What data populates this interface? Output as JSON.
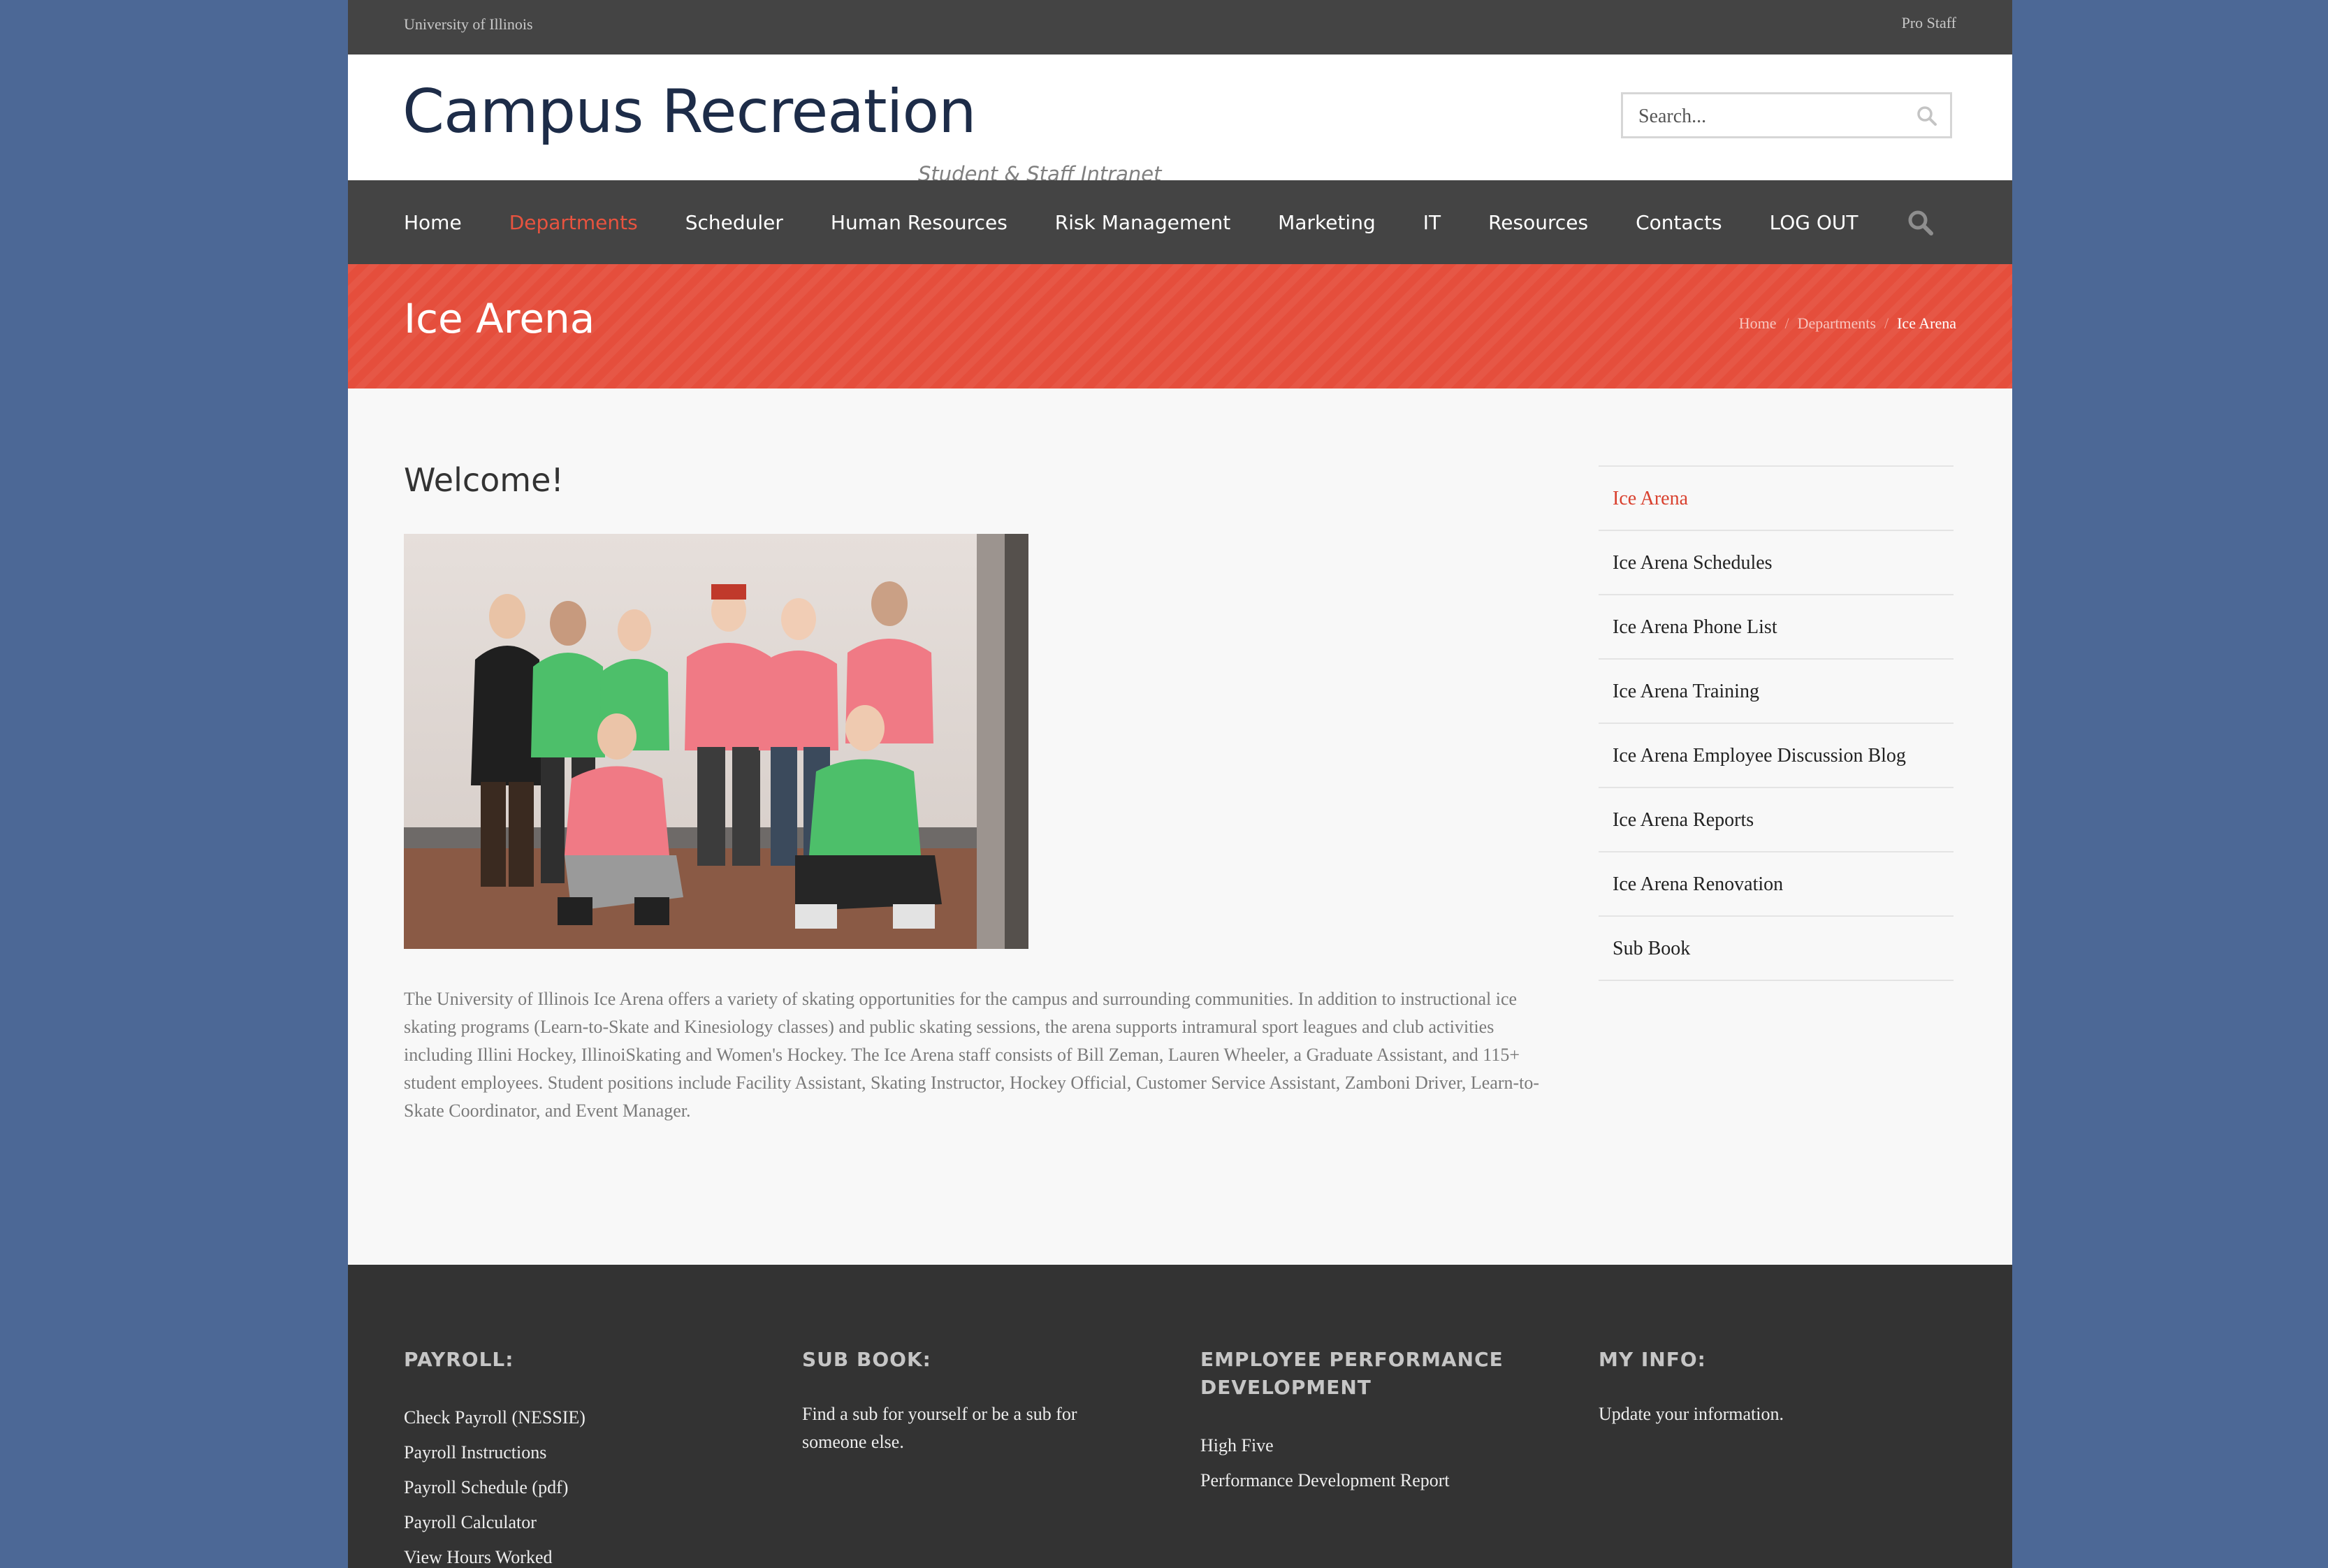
{
  "topbar": {
    "institution": "University of Illinois",
    "pro_link": "Pro Staff"
  },
  "header": {
    "brand": "Campus Recreation",
    "tagline": "Student & Staff Intranet",
    "search_placeholder": "Search..."
  },
  "nav": {
    "items": [
      {
        "label": "Home"
      },
      {
        "label": "Departments"
      },
      {
        "label": "Scheduler"
      },
      {
        "label": "Human Resources"
      },
      {
        "label": "Risk Management"
      },
      {
        "label": "Marketing"
      },
      {
        "label": "IT"
      },
      {
        "label": "Resources"
      },
      {
        "label": "Contacts"
      },
      {
        "label": "LOG OUT"
      }
    ],
    "active": "Departments",
    "search_icon": "search-icon"
  },
  "banner": {
    "title": "Ice Arena",
    "breadcrumb": [
      "Home",
      "Departments",
      "Ice Arena"
    ]
  },
  "main": {
    "heading": "Welcome!",
    "photo_alt": "Group of Ice Arena staff in pink and green Staff Olympics t-shirts",
    "body": "The University of Illinois Ice Arena offers a variety of skating opportunities for the campus and surrounding communities. In addition to instructional ice skating programs (Learn-to-Skate and Kinesiology classes) and public skating sessions, the arena supports intramural sport leagues and club activities including Illini Hockey, IllinoiSkating and Women's Hockey. The Ice Arena staff consists of Bill Zeman, Lauren Wheeler, a Graduate Assistant, and 115+ student employees. Student positions include Facility Assistant, Skating Instructor, Hockey Official, Customer Service Assistant, Zamboni Driver, Learn-to-Skate Coordinator, and Event Manager."
  },
  "sidebar": {
    "items": [
      {
        "label": "Ice Arena"
      },
      {
        "label": "Ice Arena Schedules"
      },
      {
        "label": "Ice Arena Phone List"
      },
      {
        "label": "Ice Arena Training"
      },
      {
        "label": "Ice Arena Employee Discussion Blog"
      },
      {
        "label": "Ice Arena Reports"
      },
      {
        "label": "Ice Arena Renovation"
      },
      {
        "label": "Sub Book"
      }
    ],
    "active": "Ice Arena"
  },
  "footer": {
    "payroll": {
      "heading": "PAYROLL:",
      "links": [
        "Check Payroll (NESSIE)",
        "Payroll Instructions",
        "Payroll Schedule (pdf)",
        "Payroll Calculator",
        "View Hours Worked"
      ]
    },
    "subbook": {
      "heading": "SUB BOOK:",
      "text": "Find a sub for yourself or be a sub for someone else."
    },
    "performance": {
      "heading": "EMPLOYEE PERFORMANCE DEVELOPMENT",
      "links": [
        "High Five",
        "Performance Development Report"
      ]
    },
    "myinfo": {
      "heading": "MY INFO:",
      "text": "Update your information."
    }
  },
  "colors": {
    "page_bg": "#4c6896",
    "dark_bar": "#444444",
    "accent": "#e54e3c",
    "footer_bg": "#333333"
  }
}
